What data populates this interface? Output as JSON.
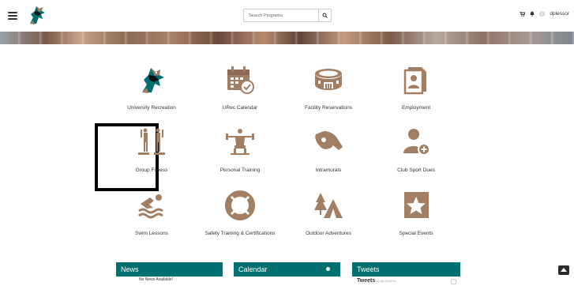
{
  "header": {
    "search": {
      "placeholder": "Search Programs"
    },
    "username": "dplessor"
  },
  "tiles": [
    {
      "label": "University Recreation",
      "icon": "chanticleer-logo-icon"
    },
    {
      "label": "URec Calendar",
      "icon": "calendar-icon"
    },
    {
      "label": "Facility Reservations",
      "icon": "stadium-icon"
    },
    {
      "label": "Employment",
      "icon": "employee-badge-icon"
    },
    {
      "label": "Group Fitness",
      "icon": "group-fitness-icon",
      "selected": true
    },
    {
      "label": "Personal Training",
      "icon": "weightlifter-icon"
    },
    {
      "label": "Intramurals",
      "icon": "whistle-icon"
    },
    {
      "label": "Club Sport Dues",
      "icon": "user-add-icon"
    },
    {
      "label": "Swim Lessons",
      "icon": "swimmer-icon"
    },
    {
      "label": "Safety Training & Certifications",
      "icon": "life-ring-icon"
    },
    {
      "label": "Outdoor Adventures",
      "icon": "tent-icon"
    },
    {
      "label": "Special Events",
      "icon": "star-icon"
    }
  ],
  "panels": {
    "news": {
      "title": "News",
      "body": "No News Available!"
    },
    "calendar": {
      "title": "Calendar"
    },
    "tweets": {
      "title": "Tweets",
      "subtitle": "Tweets",
      "by": "by @CCUURec"
    }
  },
  "colors": {
    "accent": "#006f6f",
    "icon": "#a27e63"
  }
}
